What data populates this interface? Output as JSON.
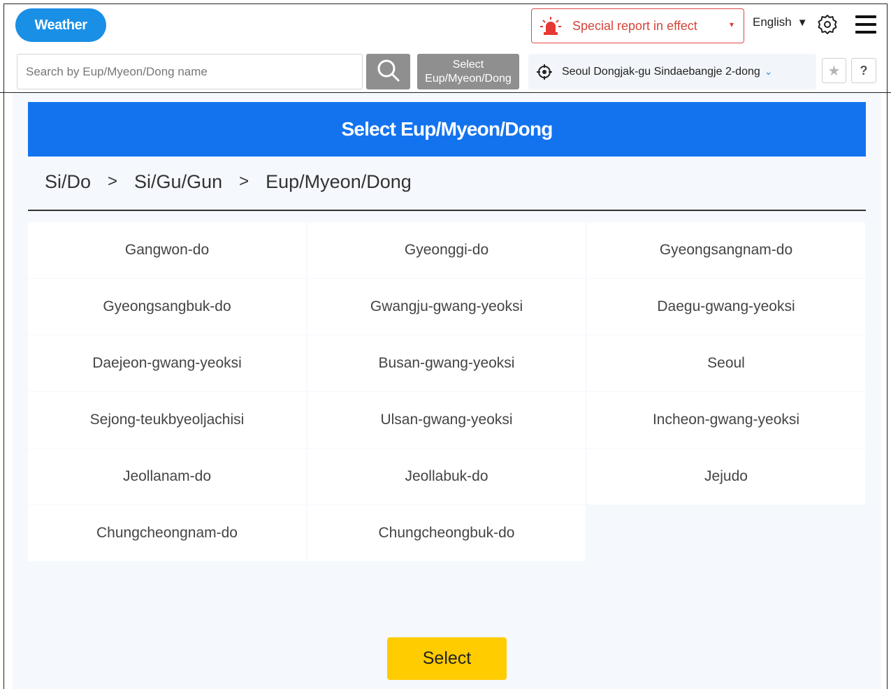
{
  "header": {
    "logo": "Weather",
    "special_report": "Special report in effect",
    "language": "English",
    "search_placeholder": "Search by Eup/Myeon/Dong name",
    "select_emd_line1": "Select",
    "select_emd_line2": "Eup/Myeon/Dong",
    "location": "Seoul Dongjak-gu Sindaebangje 2-dong",
    "help": "?"
  },
  "icons": {
    "siren": "siren-icon",
    "gear": "gear-icon",
    "menu": "menu-icon",
    "search": "search-icon",
    "location": "location-target-icon",
    "chevron": "chevron-down-icon",
    "star": "star-icon"
  },
  "colors": {
    "brand": "#1a8fe6",
    "panel_title_bg": "#1373ef",
    "alert": "#d6443a",
    "select_button": "#ffcc00"
  },
  "panel": {
    "title": "Select Eup/Myeon/Dong",
    "breadcrumb": [
      "Si/Do",
      "Si/Gu/Gun",
      "Eup/Myeon/Dong"
    ],
    "separator": ">",
    "regions": [
      "Gangwon-do",
      "Gyeonggi-do",
      "Gyeongsangnam-do",
      "Gyeongsangbuk-do",
      "Gwangju-gwang-yeoksi",
      "Daegu-gwang-yeoksi",
      "Daejeon-gwang-yeoksi",
      "Busan-gwang-yeoksi",
      "Seoul",
      "Sejong-teukbyeoljachisi",
      "Ulsan-gwang-yeoksi",
      "Incheon-gwang-yeoksi",
      "Jeollanam-do",
      "Jeollabuk-do",
      "Jejudo",
      "Chungcheongnam-do",
      "Chungcheongbuk-do"
    ],
    "select_button": "Select"
  }
}
